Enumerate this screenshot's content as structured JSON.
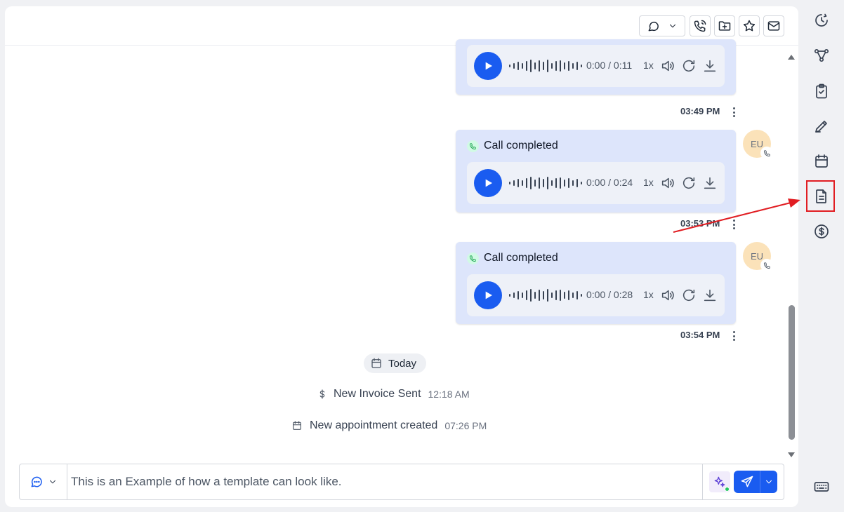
{
  "toolbar": {
    "buttons": [
      {
        "icon": "chat-bubble-icon",
        "has_dropdown": true
      },
      {
        "icon": "phone-call-icon"
      },
      {
        "icon": "folder-plus-icon"
      },
      {
        "icon": "star-icon"
      },
      {
        "icon": "mail-icon"
      }
    ]
  },
  "messages": [
    {
      "title": "",
      "player": {
        "time": "0:00 / 0:11",
        "speed": "1x"
      },
      "timestamp": "03:49 PM"
    },
    {
      "title": "Call completed",
      "avatar": "EU",
      "player": {
        "time": "0:00 / 0:24",
        "speed": "1x"
      },
      "timestamp": "03:53 PM"
    },
    {
      "title": "Call completed",
      "avatar": "EU",
      "player": {
        "time": "0:00 / 0:28",
        "speed": "1x"
      },
      "timestamp": "03:54 PM"
    }
  ],
  "date_divider": {
    "label": "Today"
  },
  "events": [
    {
      "icon": "dollar-icon",
      "text": "New Invoice Sent",
      "time": "12:18 AM"
    },
    {
      "icon": "calendar-icon",
      "text": "New appointment created",
      "time": "07:26 PM"
    }
  ],
  "composer": {
    "value": "This is an Example of how a template can look like.",
    "type_icon": "chat-bubble-icon"
  },
  "right_rail": {
    "items": [
      "history-icon",
      "workflow-icon",
      "clipboard-check-icon",
      "pen-icon",
      "calendar-icon",
      "document-icon",
      "dollar-circle-icon"
    ],
    "highlighted": "document-icon",
    "bottom": "keyboard-icon"
  },
  "colors": {
    "accent": "#1a5cf0",
    "bubble": "#dde5fb",
    "highlight": "#e11d22",
    "avatar": "#fbe2b9"
  }
}
